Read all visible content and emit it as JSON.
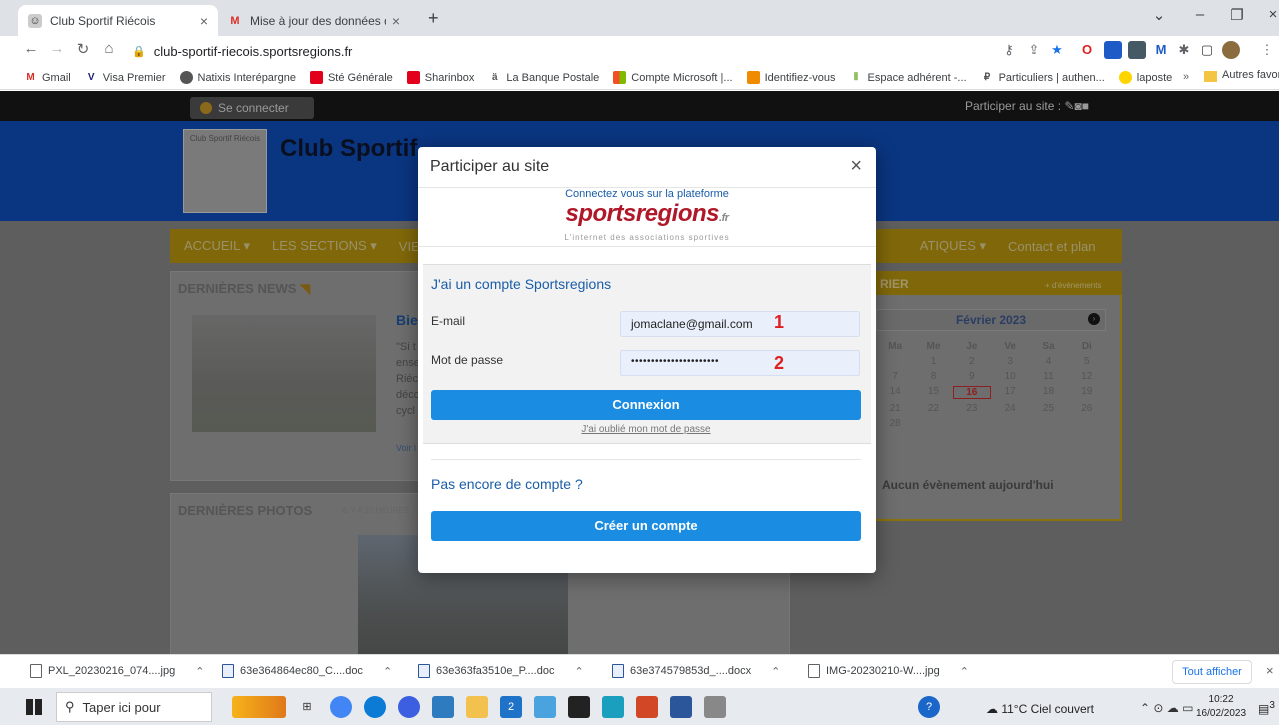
{
  "browser": {
    "tabs": [
      {
        "title": "Club Sportif Riécois",
        "active": true
      },
      {
        "title": "Mise à jour des données du porta",
        "active": false
      }
    ],
    "new_tab": "+",
    "url": "club-sportif-riecois.sportsregions.fr",
    "bookmarks": [
      "Gmail",
      "Visa Premier",
      "Natixis Interépargne",
      "Sté Générale",
      "Sharinbox",
      "La Banque Postale",
      "Compte Microsoft |...",
      "Identifiez-vous",
      "Espace adhérent -...",
      "Particuliers | authen...",
      "laposte"
    ],
    "bookmarks_more": "»",
    "other_bookmarks": "Autres favoris"
  },
  "site": {
    "connect": "Se connecter",
    "participer": "Participer au site :",
    "club_title": "Club Sportif Riécois",
    "logo_text": "Club Sportif Riécois",
    "menu": [
      "ACCUEIL ▾",
      "LES SECTIONS ▾",
      "VIE",
      "ATIQUES ▾",
      "Contact et plan"
    ],
    "news_title": "DERNIÈRES NEWS",
    "news_headline": "Bie",
    "news_excerpt": [
      "\"Si t",
      "ense",
      "Riéc",
      "décc",
      "cycl"
    ],
    "news_more": "Voir l",
    "photos_title": "DERNIÈRES PHOTOS",
    "photos_sub": "IL Y A 10 HEURES",
    "calendar_title": "RIER",
    "calendar_more": "+ d'évènements",
    "calendar_month": "Février 2023",
    "calendar_days": [
      "Ma",
      "Me",
      "Je",
      "Ve",
      "Sa",
      "Di"
    ],
    "calendar_rows": [
      [
        "",
        "1",
        "2",
        "3",
        "4",
        "5"
      ],
      [
        "7",
        "8",
        "9",
        "10",
        "11",
        "12"
      ],
      [
        "14",
        "15",
        "16",
        "17",
        "18",
        "19"
      ],
      [
        "21",
        "22",
        "23",
        "24",
        "25",
        "26"
      ],
      [
        "28",
        "",
        "",
        "",
        "",
        ""
      ]
    ],
    "calendar_today": "16",
    "no_event": "Aucun évènement aujourd'hui"
  },
  "modal": {
    "title": "Participer au site",
    "close": "×",
    "brand_caption": "Connectez vous sur la plateforme",
    "brand_name": "sportsregions",
    "brand_tld": ".fr",
    "brand_tagline": "L'internet des associations sportives",
    "login_heading": "J'ai un compte Sportsregions",
    "email_label": "E-mail",
    "email_value": "jomaclane@gmail.com",
    "password_label": "Mot de passe",
    "password_value": "••••••••••••••••••••••",
    "marker1": "1",
    "marker2": "2",
    "login_button": "Connexion",
    "forgot": "J'ai oublié mon mot de passe",
    "no_account": "Pas encore de compte ?",
    "create_button": "Créer un compte"
  },
  "downloads": {
    "items": [
      "PXL_20230216_074....jpg",
      "63e364864ec80_C....doc",
      "63e363fa3510e_P....doc",
      "63e374579853d_....docx",
      "IMG-20230210-W....jpg"
    ],
    "show_all": "Tout afficher"
  },
  "taskbar": {
    "search": "Taper ici pour",
    "weather": "11°C  Ciel couvert",
    "time": "10:22",
    "date": "16/02/2023",
    "notif": "3"
  }
}
